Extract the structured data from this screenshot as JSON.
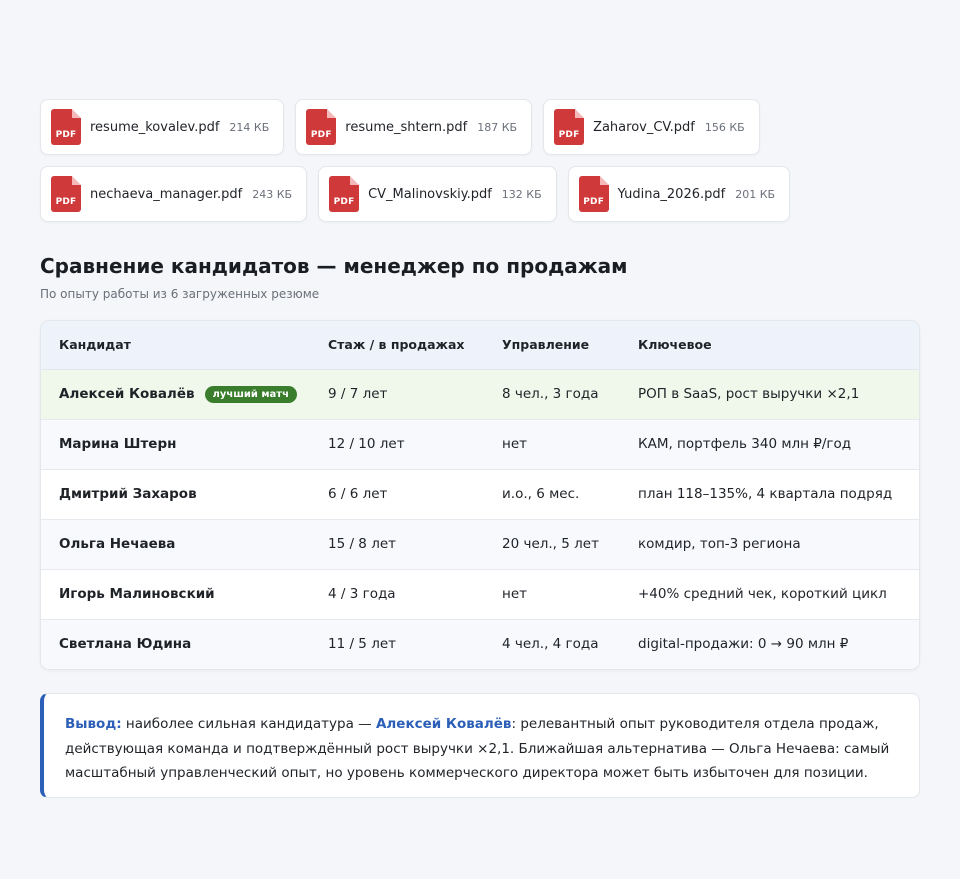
{
  "files": [
    [
      {
        "name": "resume_kovalev.pdf",
        "size": "214 КБ"
      },
      {
        "name": "resume_shtern.pdf",
        "size": "187 КБ"
      },
      {
        "name": "Zaharov_CV.pdf",
        "size": "156 КБ"
      }
    ],
    [
      {
        "name": "nechaeva_manager.pdf",
        "size": "243 КБ"
      },
      {
        "name": "CV_Malinovskiy.pdf",
        "size": "132 КБ"
      },
      {
        "name": "Yudina_2026.pdf",
        "size": "201 КБ"
      }
    ]
  ],
  "file_icon_label": "PDF",
  "title": "Сравнение кандидатов — менеджер по продажам",
  "subtitle": "По опыту работы из 6 загруженных резюме",
  "table": {
    "headers": [
      "Кандидат",
      "Стаж / в продажах",
      "Управление",
      "Ключевое"
    ],
    "best_badge": "лучший матч",
    "rows": [
      {
        "name": "Алексей Ковалёв",
        "experience": "9 / 7 лет",
        "management": "8 чел., 3 года",
        "key": "РОП в SaaS, рост выручки ×2,1"
      },
      {
        "name": "Марина Штерн",
        "experience": "12 / 10 лет",
        "management": "нет",
        "key": "КАМ, портфель 340 млн ₽/год"
      },
      {
        "name": "Дмитрий Захаров",
        "experience": "6 / 6 лет",
        "management": "и.о., 6 мес.",
        "key": "план 118–135%, 4 квартала подряд"
      },
      {
        "name": "Ольга Нечаева",
        "experience": "15 / 8 лет",
        "management": "20 чел., 5 лет",
        "key": "комдир, топ-3 региона"
      },
      {
        "name": "Игорь Малиновский",
        "experience": "4 / 3 года",
        "management": "нет",
        "key": "+40% средний чек, короткий цикл"
      },
      {
        "name": "Светлана Юдина",
        "experience": "11 / 5 лет",
        "management": "4 чел., 4 года",
        "key": "digital-продажи: 0 → 90 млн ₽"
      }
    ]
  },
  "conclusion": {
    "lead": "Вывод:",
    "text_1": " наиболее сильная кандидатура — ",
    "highlight": "Алексей Ковалёв",
    "text_2": ": релевантный опыт руководителя отдела продаж, действующая команда и подтверждённый рост выручки ×2,1. Ближайшая альтернатива — Ольга Нечаева: самый масштабный управленческий опыт, но уровень коммерческого директора может быть избыточен для позиции."
  },
  "colors": {
    "accent": "#2b5fb8",
    "best_badge": "#3a7d2c",
    "pdf_icon": "#d0393a"
  }
}
